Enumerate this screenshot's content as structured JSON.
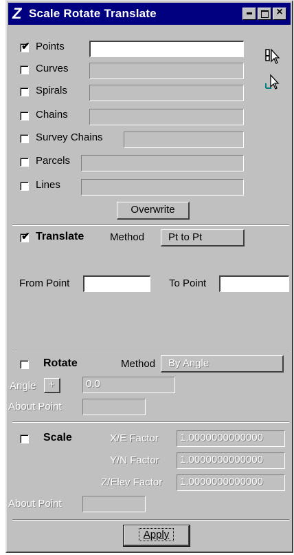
{
  "window": {
    "title": "Scale Rotate Translate",
    "logo": "Z"
  },
  "elements": {
    "items": [
      {
        "label": "Points",
        "checked": true,
        "value": ""
      },
      {
        "label": "Curves",
        "checked": false,
        "value": ""
      },
      {
        "label": "Spirals",
        "checked": false,
        "value": ""
      },
      {
        "label": "Chains",
        "checked": false,
        "value": ""
      },
      {
        "label": "Survey Chains",
        "checked": false,
        "value": ""
      },
      {
        "label": "Parcels",
        "checked": false,
        "value": ""
      },
      {
        "label": "Lines",
        "checked": false,
        "value": ""
      }
    ],
    "overwrite_label": "Overwrite"
  },
  "translate": {
    "label": "Translate",
    "checked": true,
    "method_label": "Method",
    "method_value": "Pt to Pt",
    "from_label": "From Point",
    "from_value": "",
    "to_label": "To Point",
    "to_value": ""
  },
  "rotate": {
    "label": "Rotate",
    "checked": false,
    "method_label": "Method",
    "method_value": "By Angle",
    "angle_label": "Angle",
    "angle_sign": "+",
    "angle_value": "0.0",
    "about_label": "About Point",
    "about_value": ""
  },
  "scale": {
    "label": "Scale",
    "checked": false,
    "x_label": "X/E Factor",
    "x_value": "1.0000000000000",
    "y_label": "Y/N Factor",
    "y_value": "1.0000000000000",
    "z_label": "Z/Elev Factor",
    "z_value": "1.0000000000000",
    "about_label": "About Point",
    "about_value": ""
  },
  "apply_label": "Apply",
  "icons": {
    "select": "element-select-icon",
    "pick": "pick-pointer-icon"
  }
}
